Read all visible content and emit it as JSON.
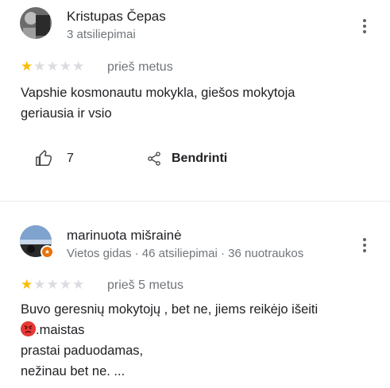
{
  "review1": {
    "author": "Kristupas Čepas",
    "meta": "3 atsiliepimai",
    "rating": 1,
    "max_rating": 5,
    "time": "prieš metus",
    "text_lines": [
      "Vapshie kosmonautu mokykla, giešos mokytoja",
      "geriausia ir vsio"
    ],
    "likes": "7",
    "share_label": "Bendrinti"
  },
  "review2": {
    "author": "marinuota mišrainė",
    "meta": "Vietos gidas · 46 atsiliepimai · 36 nuotraukos",
    "rating": 1,
    "max_rating": 5,
    "time": "prieš 5 metus",
    "line1": "Buvo geresnių mokytojų , bet ne, jiems reikėjo išeiti",
    "line2": ".maistas",
    "line3": "prastai paduodamas,",
    "line4": "nežinau bet ne. ..."
  }
}
